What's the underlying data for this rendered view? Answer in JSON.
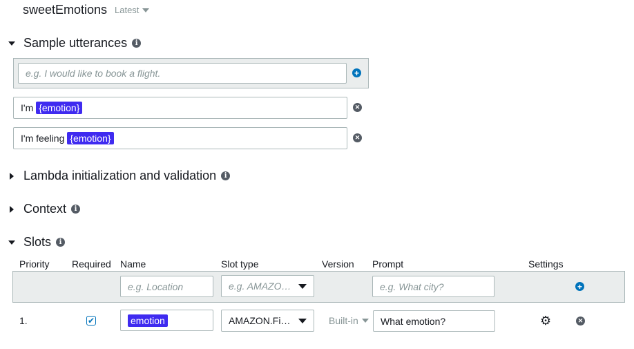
{
  "intent": {
    "name": "sweetEmotions",
    "version": "Latest"
  },
  "sections": {
    "sample_utterances": "Sample utterances",
    "lambda": "Lambda initialization and validation",
    "context": "Context",
    "slots": "Slots"
  },
  "utterances": {
    "placeholder": "e.g. I would like to book a flight.",
    "items": [
      {
        "prefix": "I'm",
        "slot": "{emotion}"
      },
      {
        "prefix": "I'm feeling",
        "slot": "{emotion}"
      }
    ]
  },
  "slots_table": {
    "headers": [
      "Priority",
      "Required",
      "Name",
      "Slot type",
      "Version",
      "Prompt",
      "Settings"
    ],
    "new_row": {
      "name_placeholder": "e.g. Location",
      "type_placeholder": "e.g. AMAZO…",
      "prompt_placeholder": "e.g. What city?"
    },
    "rows": [
      {
        "priority": "1.",
        "required": true,
        "name": "emotion",
        "slot_type": "AMAZON.Fi…",
        "version": "Built-in",
        "prompt": "What emotion?"
      }
    ]
  },
  "icons": {
    "info": "info-icon",
    "add": "plus-circle-icon",
    "remove": "x-circle-icon",
    "settings": "gear-icon"
  },
  "colors": {
    "slot_chip": "#3f2bf0",
    "link_blue": "#0073bb",
    "panel_gray": "#eaeded"
  }
}
